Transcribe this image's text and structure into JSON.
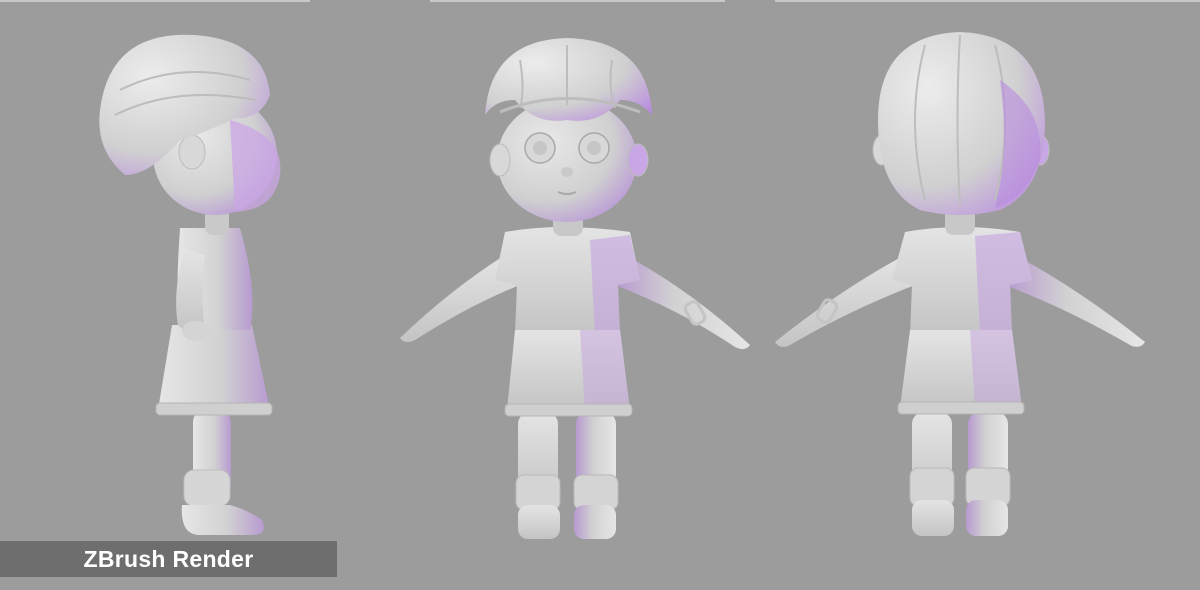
{
  "caption": {
    "label": "ZBrush Render"
  },
  "colors": {
    "background": "#9c9c9c",
    "clay": "#d9d9d9",
    "clay_shadow": "#b8b8b8",
    "rim_light": "#b87ae6",
    "caption_bar": "#6e6e6e",
    "caption_text": "#ffffff"
  },
  "views": [
    {
      "name": "side-view"
    },
    {
      "name": "front-view"
    },
    {
      "name": "back-view"
    }
  ]
}
